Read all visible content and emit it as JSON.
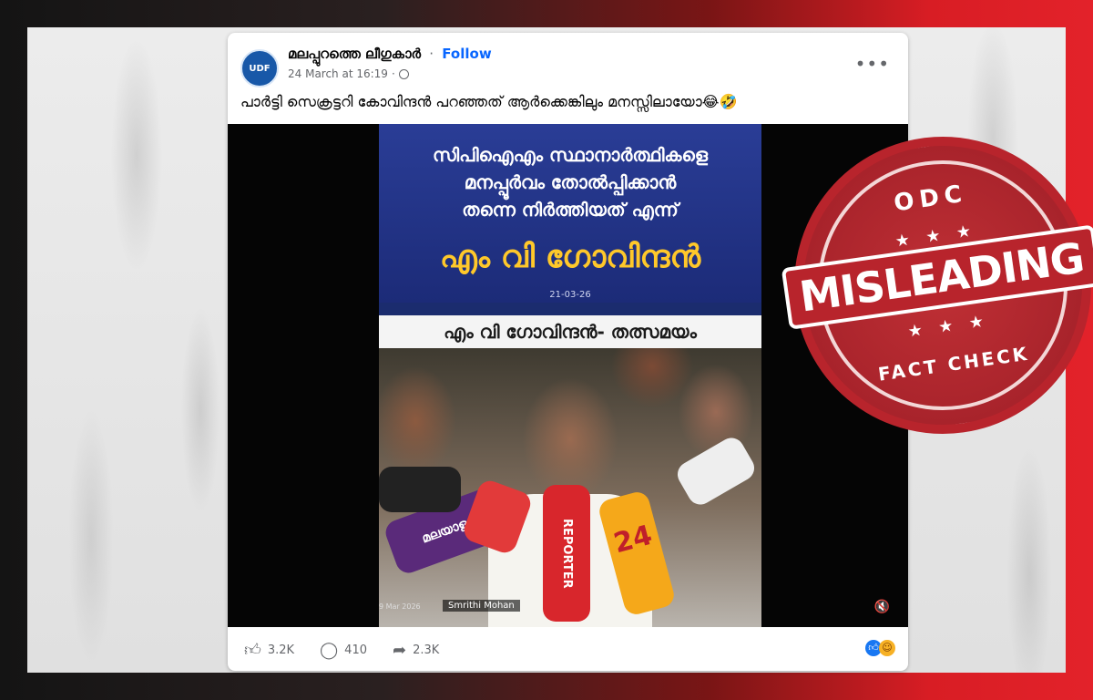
{
  "post": {
    "page_name": "മലപ്പുറത്തെ ലീഗുകാർ",
    "separator": "·",
    "follow_label": "Follow",
    "timestamp": "24 March at 16:19",
    "meta_separator": "·",
    "more_label": "•••",
    "avatar_label": "UDF",
    "caption": "പാർട്ടി സെക്രട്ടറി കോവിന്ദൻ പറഞ്ഞത് ആർക്കെങ്കിലും മനസ്സിലായോ😂🤣"
  },
  "video": {
    "headline_1": "സിപിഐഎം സ്ഥാനാർത്ഥികളെ",
    "headline_2": "മനപ്പൂർവം തോൽപ്പിക്കാൻ",
    "headline_3": "തന്നെ നിർത്തിയത് എന്ന്",
    "speaker_name": "എം വി ഗോവിന്ദൻ",
    "date": "21-03-26",
    "lower_bar": "എം വി ഗോവിന്ദൻ- തത്സമയം",
    "clip_date": "9 Mar 2026",
    "credit": "Smrithi Mohan",
    "mic_reporter": "REPORTER",
    "mic_24": "24",
    "mic_manorama": "മലയാളം",
    "mute_icon": "🔇"
  },
  "actions": {
    "likes": "3.2K",
    "comments": "410",
    "shares": "2.3K"
  },
  "stamp": {
    "brand": "ODC",
    "stars": "★ ★ ★",
    "verdict": "MISLEADING",
    "label": "FACT CHECK"
  },
  "colors": {
    "stamp_red": "#b8242c",
    "facebook_blue": "#0866ff",
    "headline_yellow": "#ffc82a"
  }
}
